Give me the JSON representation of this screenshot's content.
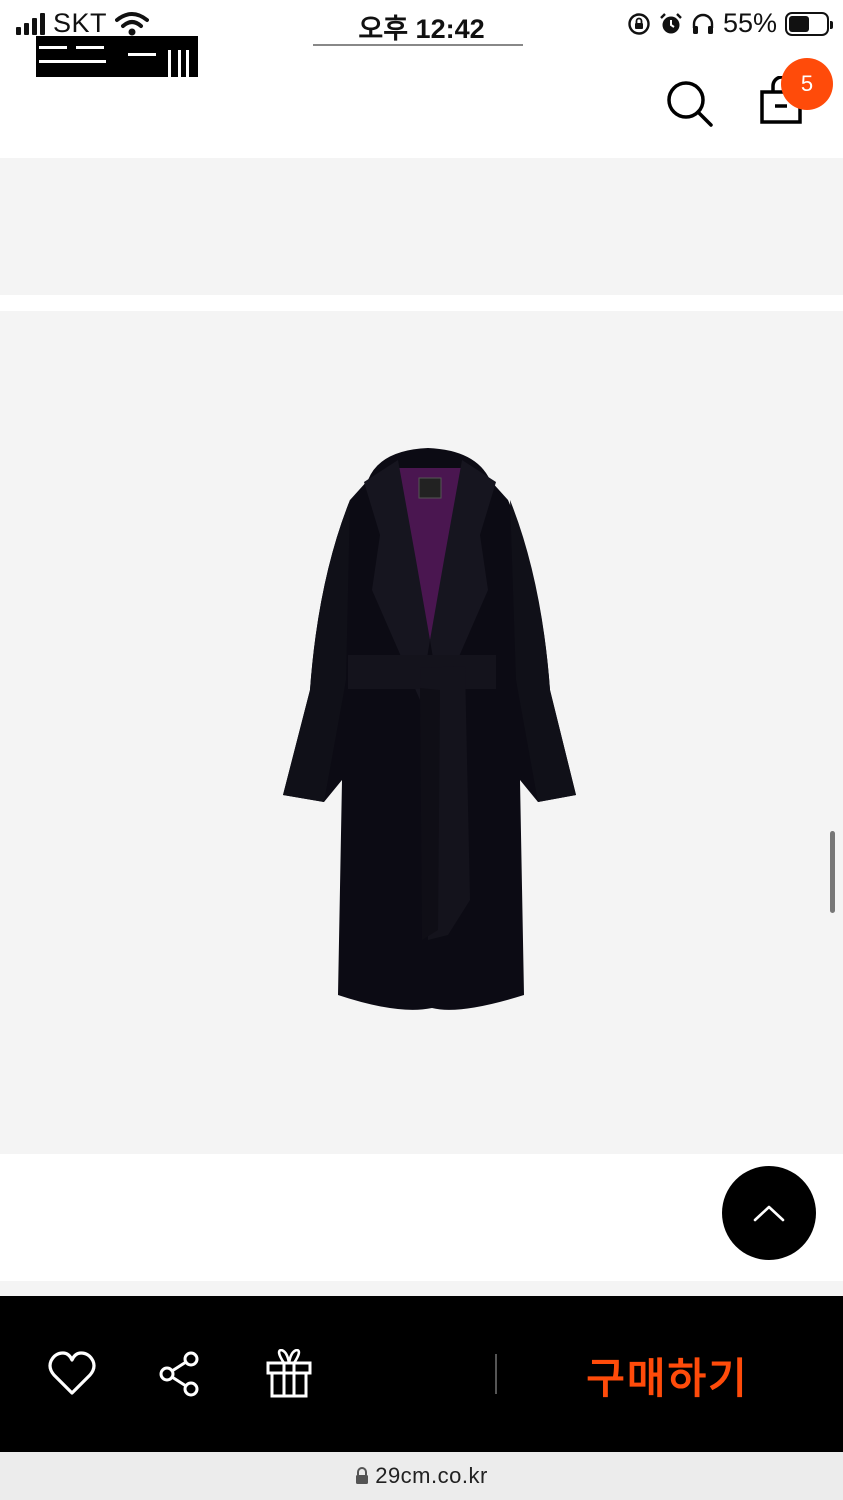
{
  "status_bar": {
    "carrier": "SKT",
    "time": "오후 12:42",
    "battery_percent": "55%",
    "battery_level": 0.55,
    "icons": [
      "signal-icon",
      "wifi-icon",
      "rotation-lock-icon",
      "alarm-icon",
      "headphones-icon",
      "battery-icon"
    ]
  },
  "header": {
    "logo_icon": "brand-logo-redacted",
    "search_icon": "search-icon",
    "cart_icon": "shopping-bag-icon",
    "cart_count": "5"
  },
  "product": {
    "image_icon": "black-wool-coat-product-image"
  },
  "floating": {
    "scroll_top_icon": "chevron-up-icon"
  },
  "action_bar": {
    "like_icon": "heart-icon",
    "share_icon": "share-icon",
    "gift_icon": "gift-icon",
    "buy_label": "구매하기"
  },
  "browser": {
    "url": "29cm.co.kr",
    "lock_icon": "lock-icon"
  },
  "colors": {
    "accent": "#ff4b0a",
    "page_gray": "#f4f4f4",
    "action_bar": "#000000"
  }
}
